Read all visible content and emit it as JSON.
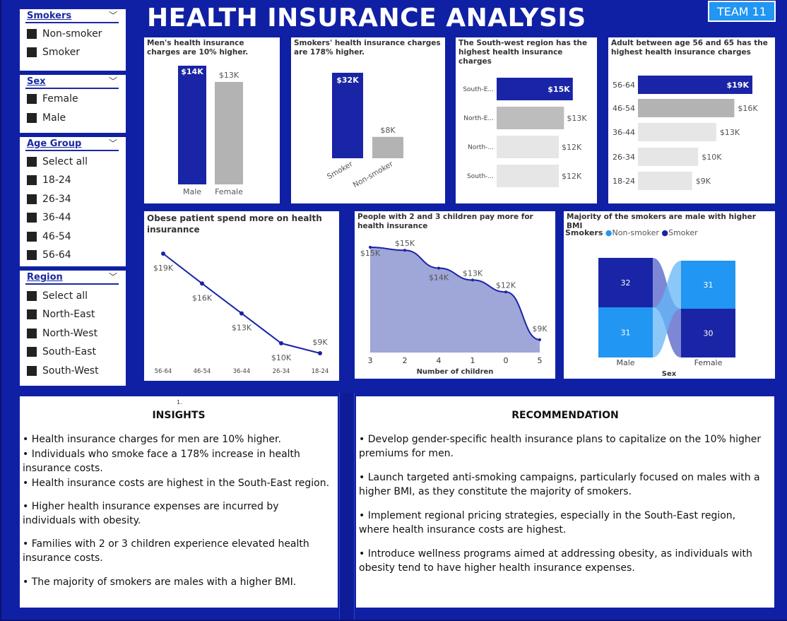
{
  "title": "HEALTH INSURANCE ANALYSIS",
  "team": "TEAM 11",
  "slicers": {
    "smokers": {
      "title": "Smokers",
      "items": [
        "Non-smoker",
        "Smoker"
      ]
    },
    "sex": {
      "title": "Sex",
      "items": [
        "Female",
        "Male"
      ]
    },
    "age_group": {
      "title": "Age Group",
      "items": [
        "Select all",
        "18-24",
        "26-34",
        "36-44",
        "46-54",
        "56-64"
      ]
    },
    "region": {
      "title": "Region",
      "items": [
        "Select all",
        "North-East",
        "North-West",
        "South-East",
        "South-West"
      ]
    }
  },
  "colors": {
    "primary": "#1a24a6",
    "gray": "#b3b3b3",
    "light": "#e6e6e6",
    "mid": "#bdbdbd",
    "accent": "#2196f3",
    "background": "#1020a4"
  },
  "chart_data": [
    {
      "type": "bar",
      "title": "Men's health insurance charges are 10% higher.",
      "categories": [
        "Male",
        "Female"
      ],
      "values": [
        14,
        13
      ],
      "value_labels": [
        "$14K",
        "$13K"
      ]
    },
    {
      "type": "bar",
      "title": "Smokers' health insurance charges are 178% higher.",
      "categories": [
        "Smoker",
        "Non-smoker"
      ],
      "values": [
        32,
        8
      ],
      "value_labels": [
        "$32K",
        "$8K"
      ]
    },
    {
      "type": "bar",
      "orientation": "horizontal",
      "title": "The South-west region has the highest health insurance charges",
      "categories": [
        "South-E...",
        "North-E...",
        "North-...",
        "South-..."
      ],
      "values": [
        15,
        13,
        12,
        12
      ],
      "value_labels": [
        "$15K",
        "$13K",
        "$12K",
        "$12K"
      ]
    },
    {
      "type": "bar",
      "orientation": "horizontal",
      "title": "Adult between age 56 and 65 has the highest health insurance charges",
      "categories": [
        "56-64",
        "46-54",
        "36-44",
        "26-34",
        "18-24"
      ],
      "values": [
        19,
        16,
        13,
        10,
        9
      ],
      "value_labels": [
        "$19K",
        "$16K",
        "$13K",
        "$10K",
        "$9K"
      ]
    },
    {
      "type": "line",
      "title": "Obese patient spend more on health insurannce",
      "categories": [
        "56-64",
        "46-54",
        "36-44",
        "26-34",
        "18-24"
      ],
      "values": [
        19,
        16,
        13,
        10,
        9
      ],
      "value_labels": [
        "$19K",
        "$16K",
        "$13K",
        "$10K",
        "$9K"
      ]
    },
    {
      "type": "area",
      "title": "People with 2 and 3 children pay more for health insurance",
      "xlabel": "Number of children",
      "categories": [
        "3",
        "2",
        "4",
        "1",
        "0",
        "5"
      ],
      "values": [
        15.4,
        15.2,
        14.0,
        13.2,
        12.4,
        9.2
      ],
      "value_labels": [
        "$15K",
        "$15K",
        "$14K",
        "$13K",
        "$12K",
        "$9K"
      ]
    },
    {
      "type": "bar",
      "stacked": true,
      "title": "Majority of the smokers are male with higher BMI",
      "xlabel": "Sex",
      "legend_title": "Smokers",
      "categories": [
        "Male",
        "Female"
      ],
      "series": [
        {
          "name": "Smoker",
          "values": [
            32,
            30
          ]
        },
        {
          "name": "Non-smoker",
          "values": [
            31,
            31
          ]
        }
      ],
      "value_labels": {
        "Male": [
          "32",
          "31"
        ],
        "Female": [
          "31",
          "30"
        ]
      }
    }
  ],
  "insights": {
    "marker": "1.",
    "title": "INSIGHTS",
    "items": [
      "• Health insurance charges for men are 10% higher.",
      "• Individuals who smoke face a 178% increase in health insurance costs.",
      "• Health insurance costs are highest in the South-East region.",
      "• Higher health insurance expenses are incurred by individuals with obesity.",
      "• Families with 2 or 3 children experience elevated health insurance costs.",
      "• The majority of smokers are males with a higher BMI."
    ]
  },
  "recommendation": {
    "title": "RECOMMENDATION",
    "items": [
      "• Develop gender-specific health insurance plans to capitalize on the 10% higher premiums for men.",
      "• Launch targeted anti-smoking campaigns, particularly focused on males with a higher BMI, as they constitute the majority of smokers.",
      "• Implement regional pricing strategies, especially in the South-East region, where health insurance costs are highest.",
      "• Introduce wellness programs aimed at addressing obesity, as individuals with obesity tend to have higher health insurance expenses."
    ]
  }
}
